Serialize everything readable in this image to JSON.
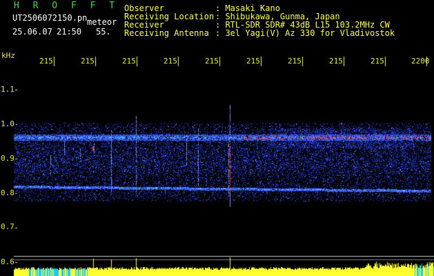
{
  "header": {
    "title": "H R O F F T",
    "filename": "UT2506072150.pn",
    "mode": "meteor",
    "date": "25.06.07",
    "time": "21:50",
    "seconds": "55."
  },
  "station": {
    "observer_label": "Observer",
    "observer_value": ": Masaki Kano",
    "location_label": "Receiving Location",
    "location_value": ": Shibukawa, Gunma, Japan",
    "receiver_label": "Receiver",
    "receiver_value": ": RTL-SDR SDR# 43dB L15 103.2MHz CW",
    "antenna_label": "Receiving Antenna",
    "antenna_value": ": 3el Yagi(V) Az 330 for Vladivostok"
  },
  "axes": {
    "unit_label": "kHz",
    "time_ticks": [
      "215",
      "215",
      "215",
      "215",
      "215",
      "215",
      "215",
      "215",
      "215",
      "2200"
    ],
    "freq_ticks": [
      "1.1",
      "1.0",
      "0.9",
      "0.8",
      "0.7",
      "0.6"
    ]
  },
  "colors": {
    "background": "#000000",
    "title_green": "#3fdc3f",
    "text_white": "#ffffff",
    "text_yellow": "#ffff4a",
    "signal_blue": "#2a4cff",
    "signal_red": "#ff3a2a",
    "level_yellow": "#ffff30",
    "level_cyan": "#18c8ff"
  }
}
